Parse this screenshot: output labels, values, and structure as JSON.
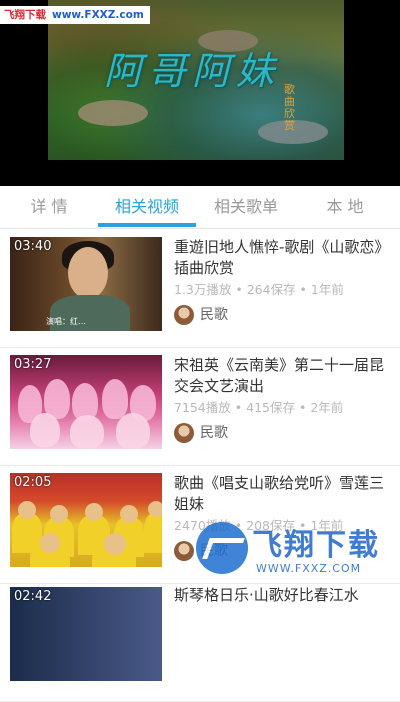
{
  "watermark_top": {
    "brand": "飞翔下载",
    "url": "www.FXXZ.com"
  },
  "video": {
    "title_art": "阿哥阿妹",
    "subtitle_art": "歌曲欣赏"
  },
  "tabs": [
    {
      "label": "详 情"
    },
    {
      "label": "相关视频",
      "active": true
    },
    {
      "label": "相关歌单"
    },
    {
      "label": "本 地"
    }
  ],
  "items": [
    {
      "duration": "03:40",
      "title": "重遊旧地人憔悴-歌剧《山歌恋》插曲欣赏",
      "plays": "1.3万播放",
      "saves": "264保存",
      "age": "1年前",
      "author": "民歌",
      "thumb_caption": "演唱：红…"
    },
    {
      "duration": "03:27",
      "title": "宋祖英《云南美》第二十一届昆交会文艺演出",
      "plays": "7154播放",
      "saves": "415保存",
      "age": "2年前",
      "author": "民歌"
    },
    {
      "duration": "02:05",
      "title": "歌曲《唱支山歌给党听》雪莲三姐妹",
      "plays": "2470播放",
      "saves": "208保存",
      "age": "1年前",
      "author": "民歌"
    },
    {
      "duration": "02:42",
      "title": "斯琴格日乐·山歌好比春江水"
    }
  ],
  "watermark_bottom": {
    "brand": "飞翔下载",
    "url": "WWW.FXXZ.COM"
  },
  "colors": {
    "accent": "#2aa3d8",
    "meta": "#b9b9b9"
  }
}
